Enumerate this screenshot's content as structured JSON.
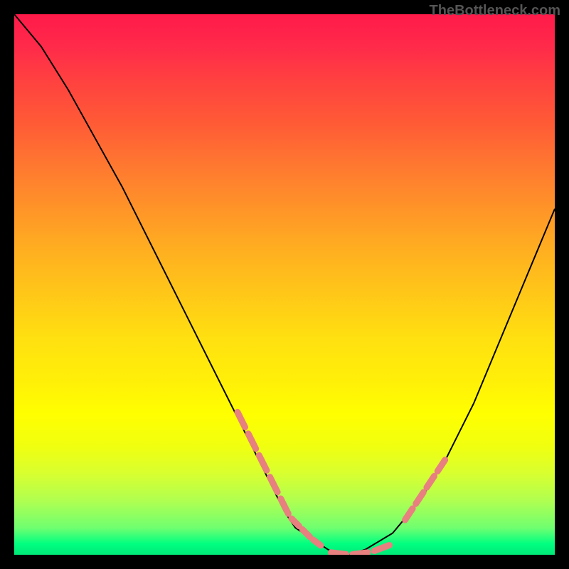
{
  "watermark": "TheBottleneck.com",
  "chart_data": {
    "type": "line",
    "title": "",
    "xlabel": "",
    "ylabel": "",
    "xlim": [
      0,
      100
    ],
    "ylim": [
      0,
      100
    ],
    "x": [
      0,
      5,
      10,
      15,
      20,
      25,
      30,
      35,
      40,
      45,
      48,
      50,
      52,
      55,
      58,
      60,
      62,
      65,
      70,
      75,
      80,
      85,
      90,
      95,
      100
    ],
    "values": [
      100,
      94,
      86,
      77,
      68,
      58,
      48,
      38,
      28,
      18,
      12,
      8,
      5,
      3,
      1,
      0,
      0,
      1,
      4,
      10,
      18,
      28,
      40,
      52,
      64
    ],
    "series": [
      {
        "name": "curve",
        "color": "#000000",
        "x": [
          0,
          5,
          10,
          15,
          20,
          25,
          30,
          35,
          40,
          45,
          48,
          50,
          52,
          55,
          58,
          60,
          62,
          65,
          70,
          75,
          80,
          85,
          90,
          95,
          100
        ],
        "y": [
          100,
          94,
          86,
          77,
          68,
          58,
          48,
          38,
          28,
          18,
          12,
          8,
          5,
          3,
          1,
          0,
          0,
          1,
          4,
          10,
          18,
          28,
          40,
          52,
          64
        ]
      },
      {
        "name": "highlight-dashes-left",
        "color": "#e88080",
        "x": [
          41,
          43,
          45,
          47,
          49,
          51,
          53,
          55,
          57
        ],
        "y": [
          27,
          23,
          19,
          15,
          11,
          7,
          5,
          3,
          1.5
        ]
      },
      {
        "name": "highlight-dashes-bottom",
        "color": "#e88080",
        "x": [
          58,
          62,
          66,
          70
        ],
        "y": [
          0.5,
          0,
          0.5,
          2
        ]
      },
      {
        "name": "highlight-dashes-right",
        "color": "#e88080",
        "x": [
          72,
          74,
          76,
          78,
          80
        ],
        "y": [
          6,
          9,
          12,
          15,
          18
        ]
      }
    ],
    "gradient_stops": [
      {
        "pos": 0,
        "color": "#ff1a4a"
      },
      {
        "pos": 20,
        "color": "#ff5a36"
      },
      {
        "pos": 40,
        "color": "#ffb020"
      },
      {
        "pos": 60,
        "color": "#ffe010"
      },
      {
        "pos": 80,
        "color": "#d8ff30"
      },
      {
        "pos": 100,
        "color": "#00e878"
      }
    ]
  }
}
